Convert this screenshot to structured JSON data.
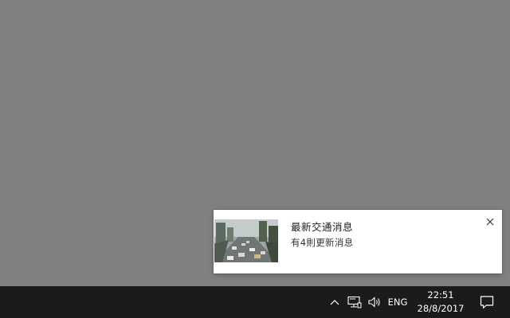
{
  "notification": {
    "title": "最新交通消息",
    "body": "有4則更新消息",
    "thumbnail": "traffic-camera-image",
    "close_icon": "close-icon"
  },
  "taskbar": {
    "icons": {
      "show_hidden": "chevron-up-icon",
      "network": "network-icon",
      "volume": "volume-icon",
      "action_center": "action-center-icon"
    },
    "language": "ENG",
    "time": "22:51",
    "date": "28/8/2017"
  },
  "colors": {
    "desktop": "#808080",
    "taskbar": "#1b1b1b",
    "toast": "#ffffff"
  }
}
